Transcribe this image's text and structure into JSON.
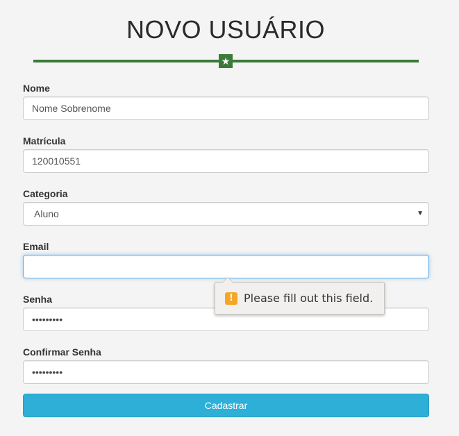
{
  "page": {
    "title": "NOVO USUÁRIO"
  },
  "form": {
    "nome": {
      "label": "Nome",
      "value": "Nome Sobrenome"
    },
    "matricula": {
      "label": "Matrícula",
      "value": "120010551"
    },
    "categoria": {
      "label": "Categoria",
      "selected": "Aluno"
    },
    "email": {
      "label": "Email",
      "value": ""
    },
    "senha": {
      "label": "Senha",
      "masked": "•••••••••"
    },
    "confirmar_senha": {
      "label": "Confirmar Senha",
      "masked": "•••••••••"
    },
    "submit_label": "Cadastrar"
  },
  "validation_tooltip": {
    "icon": "warning-icon",
    "text": "Please fill out this field."
  },
  "colors": {
    "accent_green": "#3c7a3a",
    "button_blue": "#2eafd8",
    "focus_blue": "#66afe9",
    "warning_orange": "#f5a623"
  }
}
